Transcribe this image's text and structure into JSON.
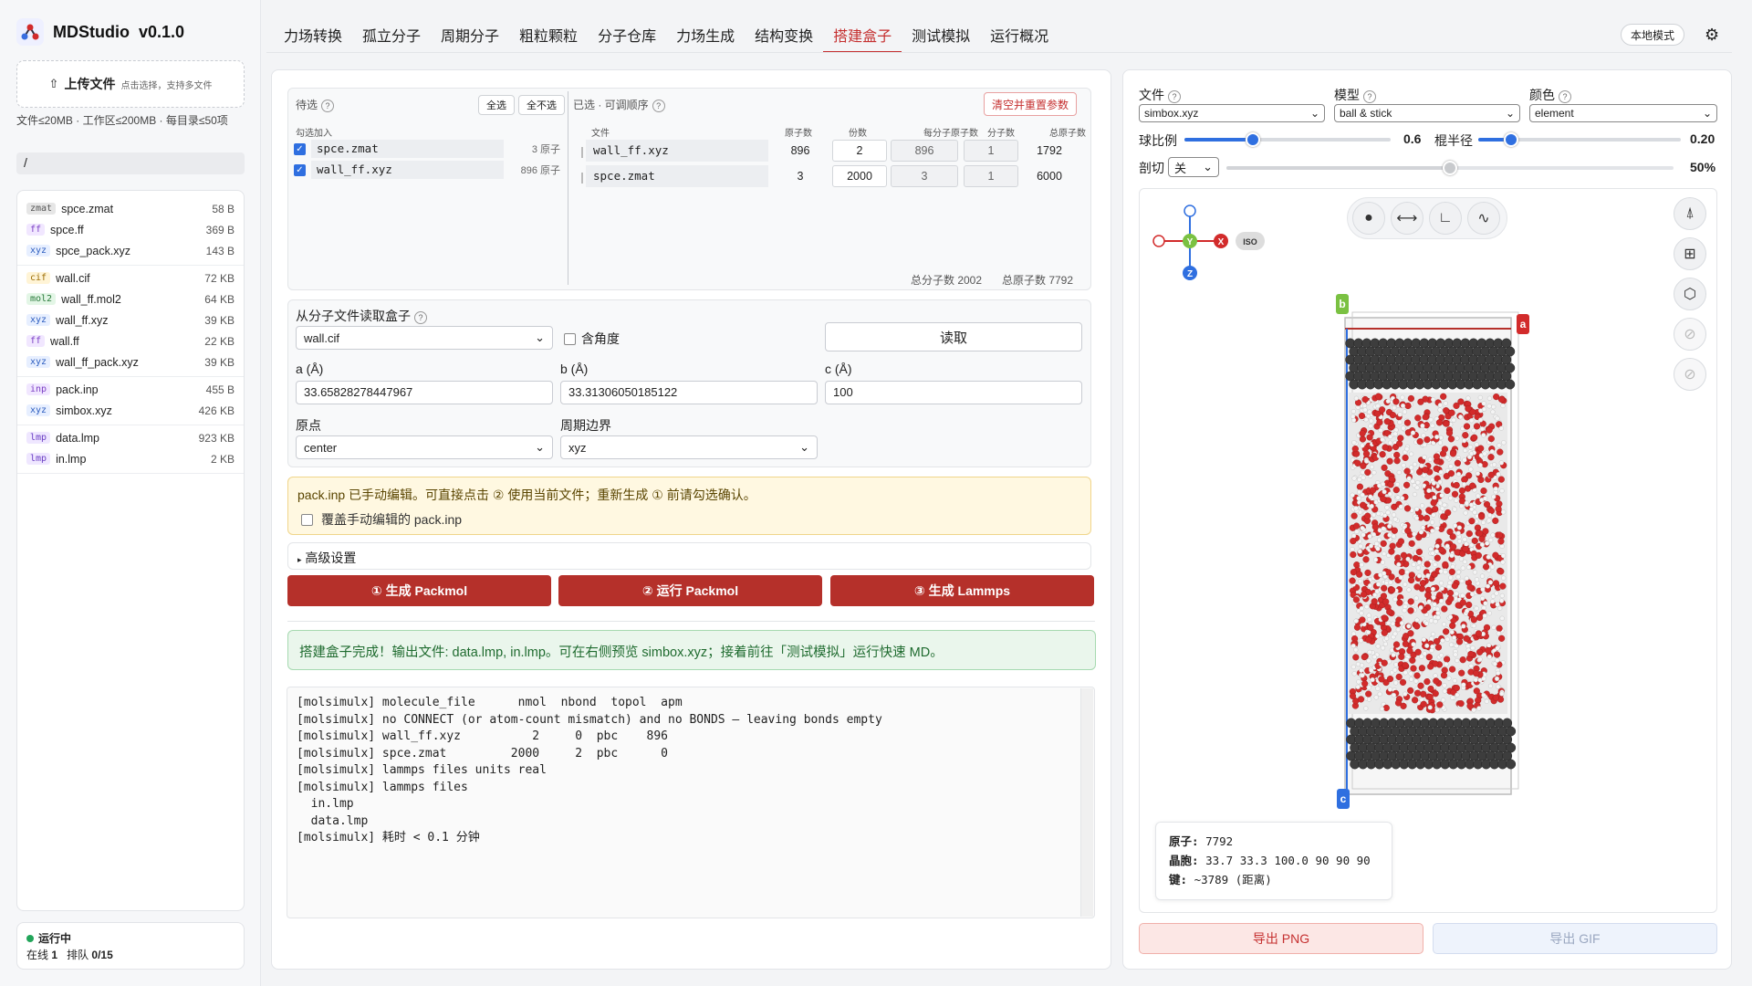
{
  "app": {
    "title": "MDStudio",
    "version": "v0.1.0"
  },
  "sidebar": {
    "upload_label": "上传文件",
    "upload_hint": "点击选择，支持多文件",
    "limits": "文件≤20MB · 工作区≤200MB · 每目录≤50项",
    "path": "/",
    "groups": [
      [
        {
          "type": "zmat",
          "name": "spce.zmat",
          "size": "58 B",
          "color": "#e6e6e6",
          "tcolor": "#555"
        },
        {
          "type": "ff",
          "name": "spce.ff",
          "size": "369 B",
          "color": "#f1e7ff",
          "tcolor": "#7b3fc4"
        },
        {
          "type": "xyz",
          "name": "spce_pack.xyz",
          "size": "143 B",
          "color": "#e7efff",
          "tcolor": "#2f5fc0"
        }
      ],
      [
        {
          "type": "cif",
          "name": "wall.cif",
          "size": "72 KB",
          "color": "#fff4d6",
          "tcolor": "#9a6a00"
        },
        {
          "type": "mol2",
          "name": "wall_ff.mol2",
          "size": "64 KB",
          "color": "#e3f6e6",
          "tcolor": "#2a7a3b"
        },
        {
          "type": "xyz",
          "name": "wall_ff.xyz",
          "size": "39 KB",
          "color": "#e7efff",
          "tcolor": "#2f5fc0"
        },
        {
          "type": "ff",
          "name": "wall.ff",
          "size": "22 KB",
          "color": "#f1e7ff",
          "tcolor": "#7b3fc4"
        },
        {
          "type": "xyz",
          "name": "wall_ff_pack.xyz",
          "size": "39 KB",
          "color": "#e7efff",
          "tcolor": "#2f5fc0"
        }
      ],
      [
        {
          "type": "inp",
          "name": "pack.inp",
          "size": "455 B",
          "color": "#f1e7ff",
          "tcolor": "#7b3fc4"
        },
        {
          "type": "xyz",
          "name": "simbox.xyz",
          "size": "426 KB",
          "color": "#e7efff",
          "tcolor": "#2f5fc0"
        }
      ],
      [
        {
          "type": "lmp",
          "name": "data.lmp",
          "size": "923 KB",
          "color": "#efe7ff",
          "tcolor": "#6b3fc4"
        },
        {
          "type": "lmp",
          "name": "in.lmp",
          "size": "2 KB",
          "color": "#efe7ff",
          "tcolor": "#6b3fc4"
        }
      ]
    ],
    "status_label": "运行中",
    "status_online_label": "在线",
    "status_online": "1",
    "status_queue_label": "排队",
    "status_queue": "0/15"
  },
  "tabs": [
    "力场转换",
    "孤立分子",
    "周期分子",
    "粗粒颗粒",
    "分子仓库",
    "力场生成",
    "结构变换",
    "搭建盒子",
    "测试模拟",
    "运行概况"
  ],
  "active_tab": 7,
  "header": {
    "local_mode": "本地模式"
  },
  "candidates": {
    "title": "待选",
    "select_all": "全选",
    "select_none": "全不选",
    "check_add_label": "勾选加入",
    "items": [
      {
        "name": "spce.zmat",
        "atoms": "3 原子",
        "checked": true
      },
      {
        "name": "wall_ff.xyz",
        "atoms": "896 原子",
        "checked": true
      }
    ]
  },
  "selected": {
    "title": "已选 · 可调顺序",
    "clear_button": "清空并重置参数",
    "headers": [
      "文件",
      "原子数",
      "份数",
      "每分子原子数",
      "分子数",
      "总原子数"
    ],
    "rows": [
      {
        "file": "wall_ff.xyz",
        "atoms": "896",
        "copies": "2",
        "per_mol": "896",
        "mols": "1",
        "total": "1792"
      },
      {
        "file": "spce.zmat",
        "atoms": "3",
        "copies": "2000",
        "per_mol": "3",
        "mols": "1",
        "total": "6000"
      }
    ],
    "total_molecules": "总分子数 2002",
    "total_atoms": "总原子数 7792"
  },
  "box_from_file": {
    "title": "从分子文件读取盒子",
    "file": "wall.cif",
    "angles_label": "含角度",
    "read_button": "读取",
    "a_label": "a (Å)",
    "a_value": "33.65828278447967",
    "b_label": "b (Å)",
    "b_value": "33.31306050185122",
    "c_label": "c (Å)",
    "c_value": "100",
    "origin_label": "原点",
    "origin_value": "center",
    "pbc_label": "周期边界",
    "pbc_value": "xyz"
  },
  "notice": {
    "text": "pack.inp 已手动编辑。可直接点击 ② 使用当前文件；重新生成 ① 前请勾选确认。",
    "override_label": "覆盖手动编辑的 pack.inp"
  },
  "advanced_label": "高级设置",
  "actions": [
    "① 生成 Packmol",
    "② 运行 Packmol",
    "③ 生成 Lammps"
  ],
  "success_message": "搭建盒子完成！输出文件: data.lmp, in.lmp。可在右侧预览 simbox.xyz；接着前往「测试模拟」运行快速 MD。",
  "log": "[molsimulx] molecule_file      nmol  nbond  topol  apm\n[molsimulx] no CONNECT (or atom-count mismatch) and no BONDS — leaving bonds empty\n[molsimulx] wall_ff.xyz          2     0  pbc    896\n[molsimulx] spce.zmat         2000     2  pbc      0\n[molsimulx] lammps files units real\n[molsimulx] lammps files\n  in.lmp\n  data.lmp\n[molsimulx] 耗时 < 0.1 分钟",
  "viewer": {
    "file_label": "文件",
    "file_value": "simbox.xyz",
    "model_label": "模型",
    "model_value": "ball & stick",
    "color_label": "颜色",
    "color_value": "element",
    "ball_scale_label": "球比例",
    "ball_scale_value": "0.6",
    "ball_scale_fraction": 0.33,
    "stick_radius_label": "棍半径",
    "stick_radius_value": "0.20",
    "stick_radius_fraction": 0.16,
    "clip_label": "剖切",
    "clip_value": "关",
    "clip_percent_value": "50%",
    "clip_fraction": 0.5,
    "axes": {
      "x": "X",
      "y": "Y",
      "z": "Z",
      "iso": "ISO"
    },
    "cell_labels": {
      "a": "a",
      "b": "b",
      "c": "c"
    },
    "info": {
      "atoms_label": "原子:",
      "atoms": "7792",
      "cell_label": "晶胞:",
      "cell": "33.7 33.3 100.0 90 90 90",
      "bonds_label": "键:",
      "bonds": "~3789 (距离)"
    },
    "export_png": "导出 PNG",
    "export_gif": "导出 GIF"
  },
  "colors": {
    "accent": "#c53030",
    "primary": "#2f6fe0",
    "oxygen": "#d22b2b",
    "hydrogen": "#f2f2f2",
    "wall": "#3d3d3d"
  }
}
